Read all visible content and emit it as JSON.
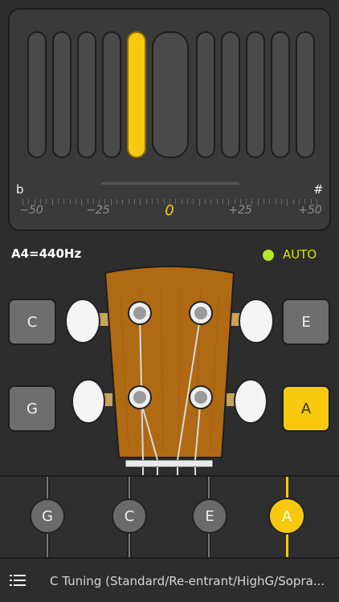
{
  "meter": {
    "flat_symbol": "b",
    "sharp_symbol": "#",
    "scale_labels": [
      "−50",
      "−25",
      "0",
      "+25",
      "+50"
    ]
  },
  "reference": {
    "label": "A4=440Hz"
  },
  "mode": {
    "label": "AUTO",
    "indicator_color": "#b8e62a"
  },
  "strings": {
    "left_top": "C",
    "left_bottom": "G",
    "right_top": "E",
    "right_bottom": "A",
    "selected": "A"
  },
  "string_selector": {
    "notes": [
      "G",
      "C",
      "E",
      "A"
    ],
    "selected_index": 3
  },
  "footer": {
    "tuning_name": "C Tuning (Standard/Re-entrant/HighG/Sopra..."
  },
  "colors": {
    "accent": "#f6c90e",
    "wood": "#b06a14"
  }
}
